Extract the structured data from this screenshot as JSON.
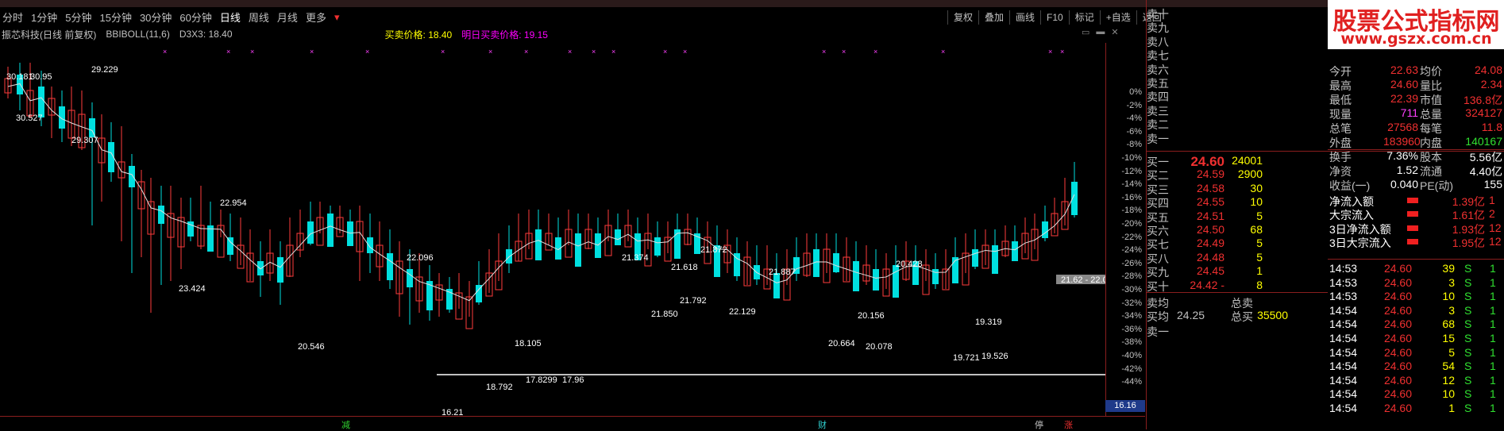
{
  "timeframes": [
    "分时",
    "1分钟",
    "5分钟",
    "15分钟",
    "30分钟",
    "60分钟",
    "日线",
    "周线",
    "月线",
    "更多"
  ],
  "active_timeframe": "日线",
  "tools": [
    "复权",
    "叠加",
    "画线",
    "F10",
    "标记",
    "+自选",
    "返回"
  ],
  "indicator": {
    "stock": "振芯科技(日线 前复权)",
    "name": "BBIBOLL(11,6)",
    "d3x3": "D3X3: 18.40",
    "buy_sell": "买卖价格: 18.40",
    "tomorrow": "明日买卖价格: 19.15"
  },
  "chart_data": {
    "type": "candlestick",
    "y_axis_ticks": [
      "0%",
      "-2%",
      "-4%",
      "-6%",
      "-8%",
      "-10%",
      "-12%",
      "-14%",
      "-16%",
      "-18%",
      "-20%",
      "-22%",
      "-24%",
      "-26%",
      "-28%",
      "-30%",
      "-32%",
      "-34%",
      "-36%",
      "-38%",
      "-40%",
      "-42%",
      "-44%"
    ],
    "price_labels": [
      "30.181",
      "30.95",
      "29.229",
      "30.527",
      "29.307",
      "22.954",
      "23.424",
      "22.096",
      "20.546",
      "21.374",
      "21.618",
      "21.872",
      "21.887",
      "21.850",
      "21.792",
      "22.129",
      "20.428",
      "20.156",
      "20.664",
      "20.078",
      "19.319",
      "19.721",
      "19.526",
      "18.105",
      "18.792",
      "17.8299",
      "17.96",
      "16.21"
    ],
    "current_price_label": "21.62 - 22.0",
    "scale_box": "16.16",
    "bottom_marks": [
      "减",
      "财",
      "停",
      "涨"
    ]
  },
  "order_book": {
    "sells": [
      {
        "l": "卖十"
      },
      {
        "l": "卖九"
      },
      {
        "l": "卖八"
      },
      {
        "l": "卖七"
      },
      {
        "l": "卖六"
      },
      {
        "l": "卖五"
      },
      {
        "l": "卖四"
      },
      {
        "l": "卖三"
      },
      {
        "l": "卖二"
      },
      {
        "l": "卖一"
      }
    ],
    "buys": [
      {
        "l": "买一",
        "p": "24.60",
        "q": "24001"
      },
      {
        "l": "买二",
        "p": "24.59",
        "q": "2900"
      },
      {
        "l": "买三",
        "p": "24.58",
        "q": "30"
      },
      {
        "l": "买四",
        "p": "24.55",
        "q": "10"
      },
      {
        "l": "买五",
        "p": "24.51",
        "q": "5"
      },
      {
        "l": "买六",
        "p": "24.50",
        "q": "68"
      },
      {
        "l": "买七",
        "p": "24.49",
        "q": "5"
      },
      {
        "l": "买八",
        "p": "24.48",
        "q": "5"
      },
      {
        "l": "买九",
        "p": "24.45",
        "q": "1"
      },
      {
        "l": "买十",
        "p": "24.42 -",
        "q": "8"
      }
    ],
    "sell_avg": "卖均",
    "sell_total": "总卖",
    "buy_avg": "买均",
    "buy_avg_val": "24.25",
    "buy_total": "总买",
    "buy_total_val": "35500",
    "last": "卖一"
  },
  "logo": {
    "t1": "股票公式指标网",
    "t2": "www.gszx.com.cn"
  },
  "quote": [
    [
      "今开",
      "22.63",
      "均价",
      "24.08"
    ],
    [
      "最高",
      "24.60",
      "量比",
      "2.34"
    ],
    [
      "最低",
      "22.39",
      "市值",
      "136.8亿"
    ],
    [
      "现量",
      "711",
      "总量",
      "324127"
    ],
    [
      "总笔",
      "27568",
      "每笔",
      "11.8"
    ],
    [
      "外盘",
      "183960",
      "内盘",
      "140167"
    ],
    [
      "换手",
      "7.36%",
      "股本",
      "5.56亿"
    ],
    [
      "净资",
      "1.52",
      "流通",
      "4.40亿"
    ],
    [
      "收益(一)",
      "0.040",
      "PE(动)",
      "155"
    ]
  ],
  "flows": [
    [
      "净流入额",
      "1.39亿",
      "1"
    ],
    [
      "大宗流入",
      "1.61亿",
      "2"
    ],
    [
      "3日净流入额",
      "1.93亿",
      "12"
    ],
    [
      "3日大宗流入",
      "1.95亿",
      "12"
    ]
  ],
  "ticks": [
    [
      "14:53",
      "24.60",
      "39",
      "S",
      "1"
    ],
    [
      "14:53",
      "24.60",
      "3",
      "S",
      "1"
    ],
    [
      "14:53",
      "24.60",
      "10",
      "S",
      "1"
    ],
    [
      "14:54",
      "24.60",
      "3",
      "S",
      "1"
    ],
    [
      "14:54",
      "24.60",
      "68",
      "S",
      "1"
    ],
    [
      "14:54",
      "24.60",
      "15",
      "S",
      "1"
    ],
    [
      "14:54",
      "24.60",
      "5",
      "S",
      "1"
    ],
    [
      "14:54",
      "24.60",
      "54",
      "S",
      "1"
    ],
    [
      "14:54",
      "24.60",
      "12",
      "S",
      "1"
    ],
    [
      "14:54",
      "24.60",
      "10",
      "S",
      "1"
    ],
    [
      "14:54",
      "24.60",
      "1",
      "S",
      "1"
    ]
  ]
}
